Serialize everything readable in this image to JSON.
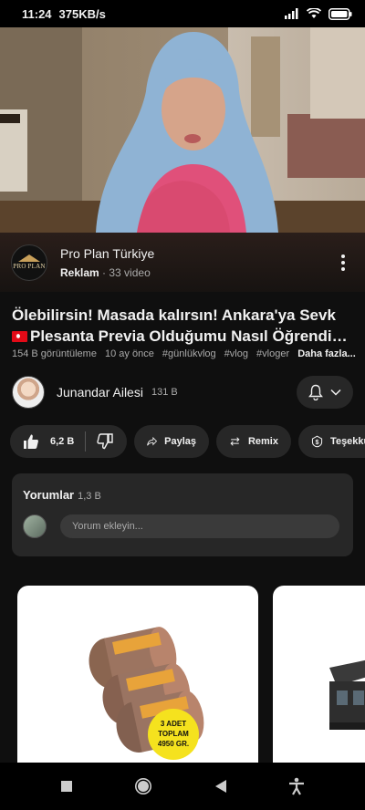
{
  "status_bar": {
    "time": "11:24",
    "speed": "375KB/s"
  },
  "ad": {
    "channel_name": "Pro Plan Türkiye",
    "label": "Reklam",
    "video_count": "· 33 video",
    "logo_text": "PRO PLAN"
  },
  "video": {
    "title_line1": "Ölebilirsin! Masada kalırsın! Ankara'ya Sevk",
    "title_line2": "Plesanta Previa Olduğumu Nasıl Öğrendim? Ko...",
    "views": "154 B görüntüleme",
    "age": "10 ay önce",
    "tags": [
      "#günlükvlog",
      "#vlog",
      "#vloger"
    ],
    "more": "Daha fazla..."
  },
  "channel": {
    "name": "Junandar Ailesi",
    "subscribers": "131 B"
  },
  "actions": {
    "likes": "6,2 B",
    "share": "Paylaş",
    "remix": "Remix",
    "thanks": "Teşekkürler"
  },
  "comments": {
    "header": "Yorumlar",
    "count": "1,3 B",
    "placeholder": "Yorum ekleyin..."
  },
  "product": {
    "badge_line1": "3 ADET",
    "badge_line2": "TOPLAM",
    "badge_line3": "4950 GR."
  },
  "colors": {
    "background": "#0f0f0f",
    "surface": "#272727",
    "text": "#f1f1f1",
    "muted": "#aaaaaa"
  }
}
